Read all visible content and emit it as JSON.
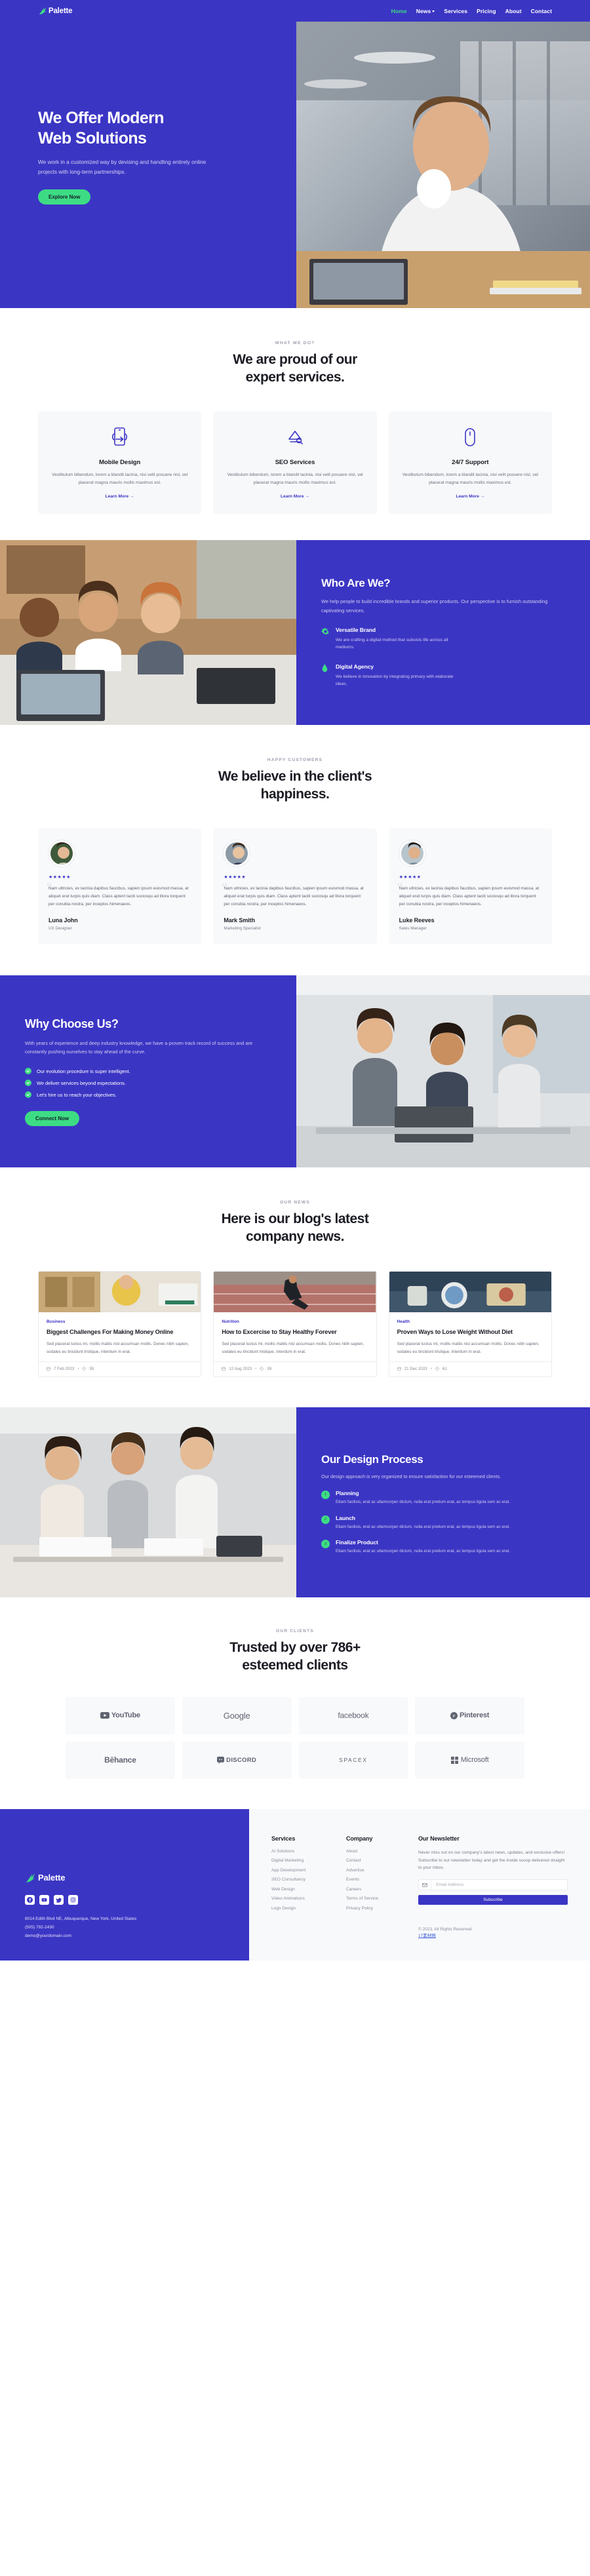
{
  "brand": {
    "name": "Palette"
  },
  "nav": {
    "items": [
      {
        "label": "Home",
        "active": true
      },
      {
        "label": "News",
        "dropdown": true
      },
      {
        "label": "Services"
      },
      {
        "label": "Pricing"
      },
      {
        "label": "About"
      },
      {
        "label": "Contact"
      }
    ]
  },
  "hero": {
    "title_line1": "We Offer Modern",
    "title_line2": "Web Solutions",
    "subtitle": "We work in a customized way by devising and handling entirely online projects with long-term partnerships.",
    "cta": "Explore Now"
  },
  "services": {
    "eyebrow": "WHAT WE DO?",
    "title_line1": "We are proud of our",
    "title_line2": "expert services.",
    "cards": [
      {
        "icon": "mobile-design-icon",
        "title": "Mobile Design",
        "body": "Vestibulum bibendum, lorem a blandit lacinia, nisi velit posuere nisl, vel placerat magna mauris mollis maximus est.",
        "link": "Learn More"
      },
      {
        "icon": "seo-services-icon",
        "title": "SEO Services",
        "body": "Vestibulum bibendum, lorem a blandit lacinia, nisi velit posuere nisl, vel placerat magna mauris mollis maximus est.",
        "link": "Learn More"
      },
      {
        "icon": "support-icon",
        "title": "24/7 Support",
        "body": "Vestibulum bibendum, lorem a blandit lacinia, nisi velit posuere nisl, vel placerat magna mauris mollis maximus est.",
        "link": "Learn More"
      }
    ]
  },
  "who": {
    "title": "Who Are We?",
    "lede": "We help people to build incredible brands and superior products. Our perspective is to furnish outstanding captivating services.",
    "features": [
      {
        "icon": "gear-icon",
        "title": "Versatile Brand",
        "body": "We are crafting a digital method that subsists life across all mediums."
      },
      {
        "icon": "flame-icon",
        "title": "Digital Agency",
        "body": "We believe in innovation by integrating primary with elaborate ideas."
      }
    ]
  },
  "testimonials": {
    "eyebrow": "HAPPY CUSTOMERS",
    "title_line1": "We believe in the client's",
    "title_line2": "happiness.",
    "stars": "★★★★★",
    "items": [
      {
        "quote": "Nam ultricies, ex lacinia dapibus faucibus, sapien ipsum euismod massa, at aliquet erat turpis quis diam. Class aptent taciti sociosqu ad litora torquent per conubia nostra, per inceptos himenaeos.",
        "name": "Luna John",
        "role": "UX Designer"
      },
      {
        "quote": "Nam ultricies, ex lacinia dapibus faucibus, sapien ipsum euismod massa, at aliquet erat turpis quis diam. Class aptent taciti sociosqu ad litora torquent per conubia nostra, per inceptos himenaeos.",
        "name": "Mark Smith",
        "role": "Marketing Specialist"
      },
      {
        "quote": "Nam ultricies, ex lacinia dapibus faucibus, sapien ipsum euismod massa, at aliquet erat turpis quis diam. Class aptent taciti sociosqu ad litora torquent per conubia nostra, per inceptos himenaeos.",
        "name": "Luke Reeves",
        "role": "Sales Manager"
      }
    ]
  },
  "why": {
    "title": "Why Choose Us?",
    "lede": "With years of experience and deep industry knowledge, we have a proven track record of success and are constantly pushing ourselves to stay ahead of the curve.",
    "checks": [
      "Our evolution procedure is super intelligent.",
      "We deliver services beyond expectations.",
      "Let's hire us to reach your objectives."
    ],
    "cta": "Connect Now"
  },
  "blog": {
    "eyebrow": "OUR NEWS",
    "title_line1": "Here is our blog's latest",
    "title_line2": "company news.",
    "posts": [
      {
        "tag": "Business",
        "title": "Biggest Challenges For Making Money Online",
        "excerpt": "Sed placerat luctus mi, mollis mattis nisl accumsan mollis. Donec nibh sapien, sodales eu tincidunt tristique, interdum in erat.",
        "date": "7 Feb 2023",
        "comments": "55"
      },
      {
        "tag": "Nutrition",
        "title": "How to Excercise to Stay Healthy Forever",
        "excerpt": "Sed placerat luctus mi, mollis mattis nisl accumsan mollis. Donec nibh sapien, sodales eu tincidunt tristique, interdum in erat.",
        "date": "12 Aug 2023",
        "comments": "39"
      },
      {
        "tag": "Health",
        "title": "Proven Ways to Lose Weight Without Diet",
        "excerpt": "Sed placerat luctus mi, mollis mattis nisl accumsan mollis. Donec nibh sapien, sodales eu tincidunt tristique, interdum in erat.",
        "date": "21 Dec 2023",
        "comments": "61"
      }
    ]
  },
  "process": {
    "title": "Our Design Process",
    "lede": "Our design approach is very organized to ensure satisfaction for our esteemed clients.",
    "steps": [
      {
        "num": "1",
        "title": "Planning",
        "body": "Etiam facilisis, erat ac ullamcorper dictum, nulla erat pretium erat, ac tempus ligula sem ac erat."
      },
      {
        "num": "2",
        "title": "Launch",
        "body": "Etiam facilisis, erat ac ullamcorper dictum, nulla erat pretium erat, ac tempus ligula sem ac erat."
      },
      {
        "num": "3",
        "title": "Finalize Product",
        "body": "Etiam facilisis, erat ac ullamcorper dictum, nulla erat pretium erat, ac tempus ligula sem ac erat."
      }
    ]
  },
  "clients": {
    "eyebrow": "OUR CLIENTS",
    "title_line1": "Trusted by over 786+",
    "title_line2": "esteemed clients",
    "logos": [
      {
        "name": "YouTube",
        "icon": "youtube-icon"
      },
      {
        "name": "Google",
        "icon": "google-wordmark"
      },
      {
        "name": "facebook",
        "icon": "facebook-wordmark"
      },
      {
        "name": "Pinterest",
        "icon": "pinterest-icon"
      },
      {
        "name": "Bēhance",
        "icon": "behance-wordmark"
      },
      {
        "name": "DISCORD",
        "icon": "discord-icon"
      },
      {
        "name": "SPACEX",
        "icon": "spacex-wordmark"
      },
      {
        "name": "Microsoft",
        "icon": "microsoft-icon"
      }
    ]
  },
  "footer": {
    "address": "8014 Edith Blvd NE, Albuquerque, New York, United States",
    "phone": "(505) 792-2430",
    "email": "demo@yourdomain.com",
    "socials": [
      {
        "icon": "facebook-icon"
      },
      {
        "icon": "youtube-icon"
      },
      {
        "icon": "twitter-icon"
      },
      {
        "icon": "instagram-icon"
      }
    ],
    "services": {
      "title": "Services",
      "links": [
        "AI Solutions",
        "Digital Marketing",
        "App Development",
        "SEO Consultancy",
        "Web Design",
        "Video Animations",
        "Logo Design"
      ]
    },
    "company": {
      "title": "Company",
      "links": [
        "About",
        "Contact",
        "Advertise",
        "Events",
        "Careers",
        "Terms of Service",
        "Privacy Policy"
      ]
    },
    "newsletter": {
      "title": "Our Newsletter",
      "body": "Never miss out on our company's latest news, updates, and exclusive offers! Subscribe to our newsletter today and get the inside scoop delivered straight to your inbox.",
      "placeholder": "Email Address",
      "email_value": "",
      "button": "Subscribe"
    },
    "copyright": "© 2023. All Rights Reserved.",
    "credit": "17素材网"
  },
  "colors": {
    "brand_blue": "#3b35c4",
    "accent_green": "#3ddc84",
    "dark": "#1c1d24"
  }
}
